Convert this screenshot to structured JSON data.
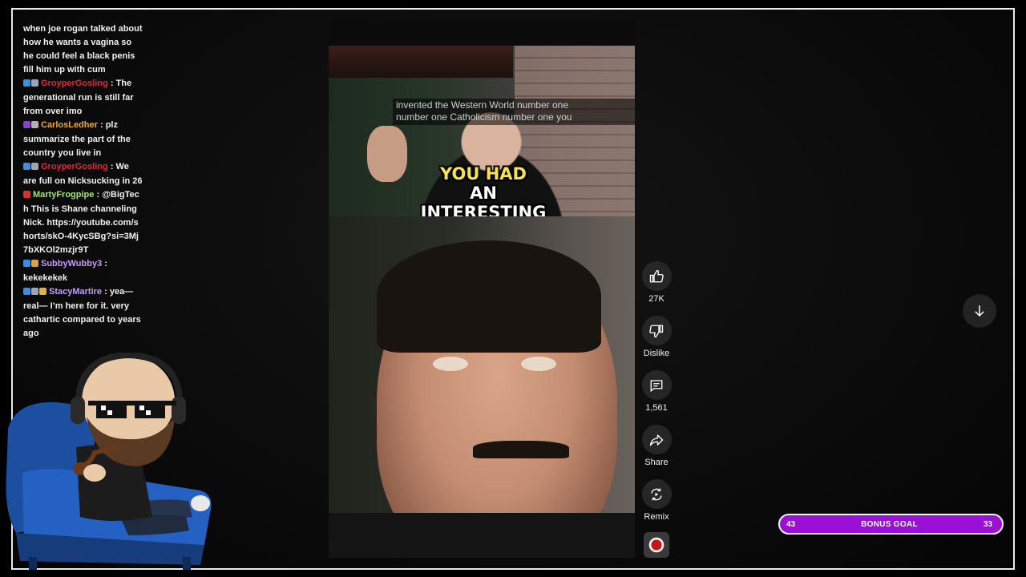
{
  "chat": {
    "messages": [
      {
        "user": "",
        "user_color": "",
        "badges": [],
        "text": "when joe rogan talked about how he wants a vagina so he could feel a black penis fill him up with cum"
      },
      {
        "user": "GroyperGosling",
        "user_color": "#e0253a",
        "badges": [
          "#3b8ee8",
          "#9aa7b8"
        ],
        "text": ": The generational run is still far from over imo"
      },
      {
        "user": "CarlosLedher",
        "user_color": "#f5a623",
        "badges": [
          "#8a3fd1",
          "#b0b0b0"
        ],
        "text": ": plz summarize the part of the country you live in"
      },
      {
        "user": "GroyperGosling",
        "user_color": "#e0253a",
        "badges": [
          "#3b8ee8",
          "#9aa7b8"
        ],
        "text": ": We are full on Nicksucking in 26"
      },
      {
        "user": "MartyFrogpipe",
        "user_color": "#a6e56b",
        "badges": [
          "#d33333"
        ],
        "text": ": @BigTech This is Shane channeling Nick. https://youtube.com/shorts/skO-4KycSBg?si=3Mj7bXKOl2mzjr9T"
      },
      {
        "user": "SubbyWubby3",
        "user_color": "#c79bff",
        "badges": [
          "#3b8ee8",
          "#d9a04a"
        ],
        "text": ": kekekekek"
      },
      {
        "user": "StacyMartire",
        "user_color": "#c79bff",
        "badges": [
          "#3b8ee8",
          "#9aa7b8",
          "#e0b13c"
        ],
        "text": ": yea— real— I’m here for it. very cathartic compared to years ago"
      }
    ]
  },
  "video": {
    "cc_line1": "invented the Western World number one",
    "cc_line2": "number one Catholicism number one you",
    "caption_line1": "YOU HAD",
    "caption_line2": "AN",
    "caption_line3": "INTERESTING"
  },
  "actions": {
    "like_count": "27K",
    "dislike_label": "Dislike",
    "comment_count": "1,561",
    "share_label": "Share",
    "remix_label": "Remix"
  },
  "goal": {
    "left_value": "43",
    "title": "BONUS GOAL",
    "right_value": "33",
    "color": "#9b10d6"
  }
}
